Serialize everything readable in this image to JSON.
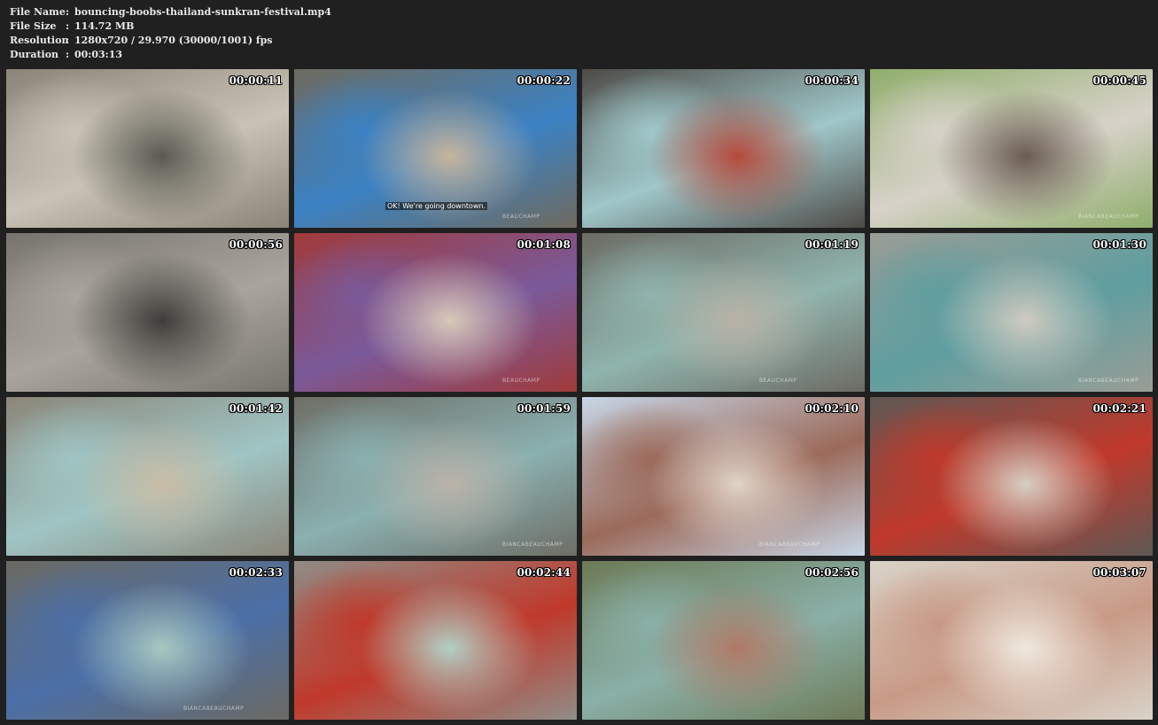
{
  "file_info": {
    "rows": [
      {
        "label": "File Name",
        "sep": ":",
        "value": "bouncing-boobs-thailand-sunkran-festival.mp4"
      },
      {
        "label": "File Size",
        "sep": ":",
        "value": "114.72 MB"
      },
      {
        "label": "Resolution",
        "sep": ":",
        "value": "1280x720 / 29.970 (30000/1001) fps"
      },
      {
        "label": "Duration",
        "sep": ":",
        "value": "00:03:13"
      }
    ]
  },
  "thumbnails": [
    {
      "timestamp": "00:00:11",
      "palette": [
        "#8a8476",
        "#c9c3b5",
        "#5a5a52"
      ]
    },
    {
      "timestamp": "00:00:22",
      "palette": [
        "#6f6a5e",
        "#3b82c4",
        "#c7b59d"
      ],
      "subtitle": "OK! We're going downtown.",
      "watermark": "BEAUCHAMP"
    },
    {
      "timestamp": "00:00:34",
      "palette": [
        "#4d4a46",
        "#9fc7c9",
        "#b44a3c"
      ]
    },
    {
      "timestamp": "00:00:45",
      "palette": [
        "#8fae6b",
        "#d7d2c9",
        "#6b5c53"
      ],
      "watermark": "BIANCABEAUCHAMP"
    },
    {
      "timestamp": "00:00:56",
      "palette": [
        "#77746e",
        "#a9a59d",
        "#3f3d3a"
      ]
    },
    {
      "timestamp": "00:01:08",
      "palette": [
        "#a03a3a",
        "#7a5a9a",
        "#d8c8b8"
      ],
      "watermark": "BEAUCHAMP"
    },
    {
      "timestamp": "00:01:19",
      "palette": [
        "#6c6b63",
        "#8fb4ad",
        "#b8b2a6"
      ],
      "watermark": "BEAUCHAMP"
    },
    {
      "timestamp": "00:01:30",
      "palette": [
        "#9a9d95",
        "#5f9ea0",
        "#cfcac0"
      ],
      "watermark": "BIANCABEAUCHAMP"
    },
    {
      "timestamp": "00:01:42",
      "palette": [
        "#8b8679",
        "#9fc5c4",
        "#c8bca6"
      ]
    },
    {
      "timestamp": "00:01:59",
      "palette": [
        "#6e6e66",
        "#8ab0b0",
        "#b9b2a8"
      ],
      "watermark": "BIANCABEAUCHAMP"
    },
    {
      "timestamp": "00:02:10",
      "palette": [
        "#c7d6e6",
        "#9b6a5a",
        "#e0d4c8"
      ],
      "watermark": "BIANCABEAUCHAMP"
    },
    {
      "timestamp": "00:02:21",
      "palette": [
        "#5e5955",
        "#c0392b",
        "#d6cfc4"
      ]
    },
    {
      "timestamp": "00:02:33",
      "palette": [
        "#6b6a62",
        "#4b6fa8",
        "#a7c8c0"
      ],
      "watermark": "BIANCABEAUCHAMP"
    },
    {
      "timestamp": "00:02:44",
      "palette": [
        "#8f8d87",
        "#c0392b",
        "#b2d0c6"
      ]
    },
    {
      "timestamp": "00:02:56",
      "palette": [
        "#6d7a56",
        "#8ab0a8",
        "#b07a66"
      ]
    },
    {
      "timestamp": "00:03:07",
      "palette": [
        "#d9d3c8",
        "#c89a86",
        "#efe9df"
      ]
    }
  ]
}
